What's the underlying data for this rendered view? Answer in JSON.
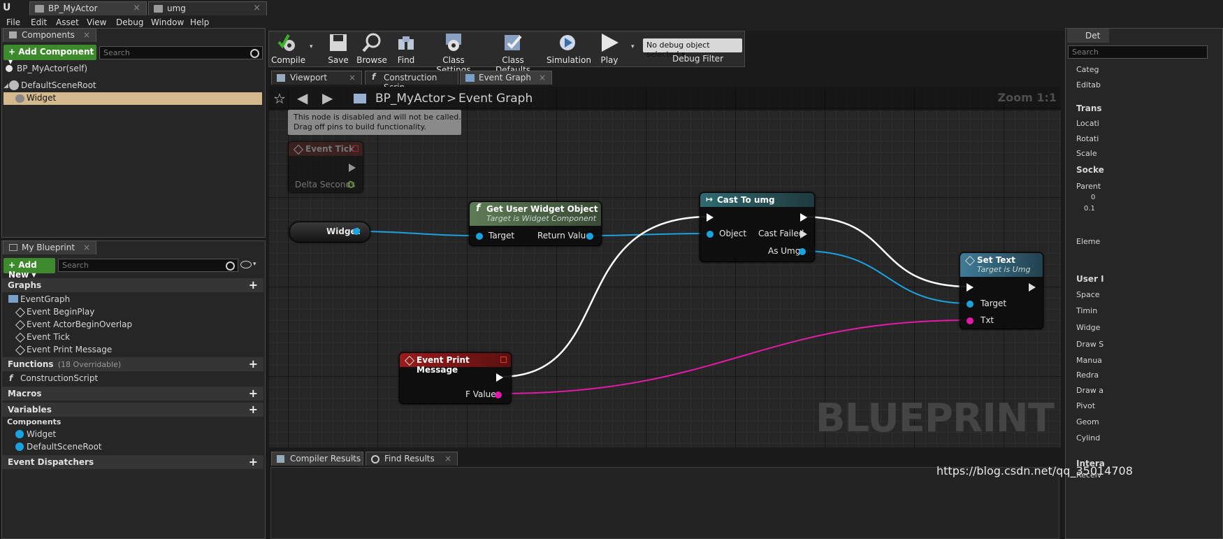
{
  "title_tabs": [
    {
      "label": "BP_MyActor"
    },
    {
      "label": "umg"
    }
  ],
  "menu": [
    "File",
    "Edit",
    "Asset",
    "View",
    "Debug",
    "Window",
    "Help"
  ],
  "components_panel": {
    "tab_label": "Components",
    "add_button": "+ Add Component ▾",
    "search_placeholder": "Search",
    "self_label": "BP_MyActor(self)",
    "tree": [
      {
        "label": "DefaultSceneRoot"
      },
      {
        "label": "Widget"
      }
    ]
  },
  "my_blueprint": {
    "tab_label": "My Blueprint",
    "add_button": "+ Add New ▾",
    "search_placeholder": "Search",
    "graphs_label": "Graphs",
    "event_graph": "EventGraph",
    "events": [
      "Event BeginPlay",
      "Event ActorBeginOverlap",
      "Event Tick",
      "Event Print Message"
    ],
    "functions_label": "Functions",
    "functions_count": "(18 Overridable)",
    "construction_script": "ConstructionScript",
    "macros_label": "Macros",
    "variables_label": "Variables",
    "components_label": "Components",
    "component_vars": [
      "Widget",
      "DefaultSceneRoot"
    ],
    "dispatchers_label": "Event Dispatchers"
  },
  "toolbar": {
    "compile": "Compile",
    "save": "Save",
    "browse": "Browse",
    "find": "Find",
    "class_settings": "Class Settings",
    "class_defaults": "Class Defaults",
    "simulation": "Simulation",
    "play": "Play",
    "debug_select": "No debug object selected ▾",
    "debug_filter": "Debug Filter"
  },
  "editor_tabs": [
    "Viewport",
    "Construction Scrip",
    "Event Graph"
  ],
  "graph": {
    "breadcrumb_root": "BP_MyActor",
    "breadcrumb_sep": ">",
    "breadcrumb_leaf": "Event Graph",
    "zoom": "Zoom 1:1",
    "watermark": "BLUEPRINT",
    "disabled_note_line1": "This node is disabled and will not be called.",
    "disabled_note_line2": "Drag off pins to build functionality.",
    "nodes": {
      "event_tick": {
        "title": "Event Tick",
        "pin": "Delta Seconds"
      },
      "widget_var": {
        "label": "Widget"
      },
      "get_widget": {
        "title": "Get User Widget Object",
        "subtitle": "Target is Widget Component",
        "in": "Target",
        "out": "Return Value"
      },
      "cast": {
        "title": "Cast To umg",
        "in": "Object",
        "failed": "Cast Failed",
        "out": "As Umg"
      },
      "set_text": {
        "title": "Set Text",
        "subtitle": "Target is Umg",
        "target": "Target",
        "txt": "Txt"
      },
      "print_msg": {
        "title": "Event Print Message",
        "pin": "F Value"
      }
    }
  },
  "bottom_tabs": [
    "Compiler Results",
    "Find Results"
  ],
  "details": {
    "tab_label": "Det",
    "search_placeholder": "Search",
    "rows": [
      "Categ",
      "Editab",
      "Trans",
      "Locati",
      "Rotati",
      "Scale",
      "Socke",
      "Parent",
      "0",
      "0.1",
      "Eleme",
      "User I",
      "Space",
      "Timin",
      "Widge",
      "Draw S",
      "Manua",
      "Redra",
      "Draw a",
      "Pivot",
      "Geom",
      "Cylind",
      "Intera",
      "Receiv"
    ]
  },
  "csdn_watermark": "https://blog.csdn.net/qq_35014708",
  "colors": {
    "exec": "#ffffff",
    "object": "#1ba3e0",
    "string": "#e21aa8",
    "float": "#8ad33a",
    "event_red": "#8a1616",
    "func_green": "#4d6b45",
    "cast_teal": "#2b5b60",
    "settext_blue": "#3a6e86"
  }
}
